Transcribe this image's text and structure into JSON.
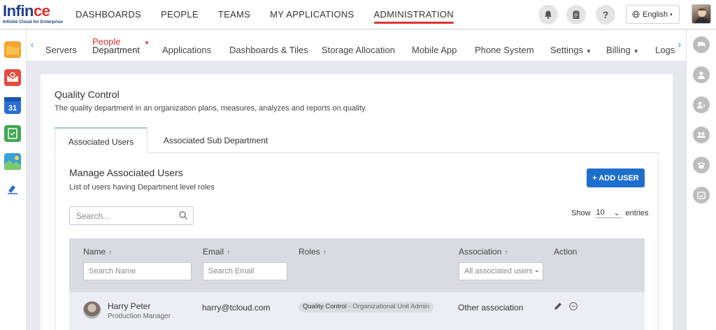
{
  "brand": {
    "name_a": "Infin",
    "name_b": "ce",
    "tagline": "Infinite Cloud for Enterprise"
  },
  "topnav": [
    {
      "label": "DASHBOARDS",
      "active": false
    },
    {
      "label": "PEOPLE",
      "active": false
    },
    {
      "label": "TEAMS",
      "active": false
    },
    {
      "label": "MY APPLICATIONS",
      "active": false
    },
    {
      "label": "ADMINISTRATION",
      "active": true
    }
  ],
  "header": {
    "language": "English"
  },
  "subnav": {
    "people_label": "People",
    "items": [
      "Servers",
      "Department",
      "Applications",
      "Dashboards & Tiles",
      "Storage Allocation",
      "Mobile App",
      "Phone System",
      "Settings",
      "Billing",
      "Logs"
    ]
  },
  "page": {
    "title": "Quality Control",
    "description": "The quality department in an organization plans, measures, analyzes and reports on quality.",
    "tabs": [
      "Associated Users",
      "Associated Sub Department"
    ]
  },
  "panel": {
    "title": "Manage Associated Users",
    "subtitle": "List of users having Department level roles",
    "add_button": "+ ADD USER",
    "search_placeholder": "Search...",
    "show_label": "Show",
    "entries_value": "10",
    "entries_label": "entries"
  },
  "table": {
    "columns": [
      "Name",
      "Email",
      "Roles",
      "Association",
      "Action"
    ],
    "filters": {
      "name_placeholder": "Search Name",
      "email_placeholder": "Search Email",
      "association_value": "All associated users"
    },
    "rows": [
      {
        "name": "Harry Peter",
        "title": "Production Manager",
        "email": "harry@tcloud.com",
        "role_main": "Quality Control",
        "role_detail": " - Organizational Unit Admin",
        "association": "Other association"
      }
    ]
  },
  "colors": {
    "accent": "#1e6fcc",
    "active_underline": "#e13333",
    "table_header": "#d8dbe2"
  }
}
